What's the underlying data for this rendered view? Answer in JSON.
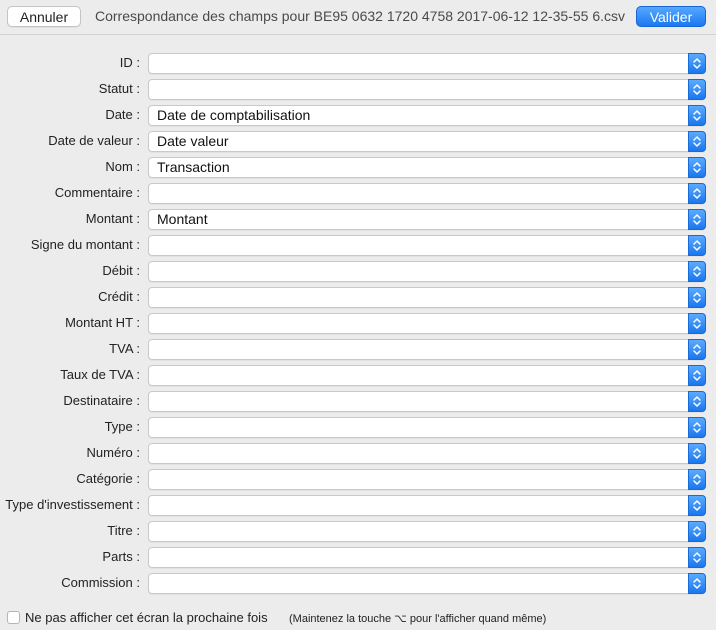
{
  "toolbar": {
    "cancel_label": "Annuler",
    "title": "Correspondance des champs pour BE95 0632 1720 4758 2017-06-12 12-35-55 6.csv",
    "ok_label": "Valider"
  },
  "fields": [
    {
      "label": "ID :",
      "value": ""
    },
    {
      "label": "Statut :",
      "value": ""
    },
    {
      "label": "Date :",
      "value": "Date de comptabilisation"
    },
    {
      "label": "Date de valeur :",
      "value": "Date valeur"
    },
    {
      "label": "Nom :",
      "value": "Transaction"
    },
    {
      "label": "Commentaire :",
      "value": ""
    },
    {
      "label": "Montant :",
      "value": "Montant"
    },
    {
      "label": "Signe du montant :",
      "value": ""
    },
    {
      "label": "Débit :",
      "value": ""
    },
    {
      "label": "Crédit :",
      "value": ""
    },
    {
      "label": "Montant HT :",
      "value": ""
    },
    {
      "label": "TVA :",
      "value": ""
    },
    {
      "label": "Taux de TVA :",
      "value": ""
    },
    {
      "label": "Destinataire :",
      "value": ""
    },
    {
      "label": "Type :",
      "value": ""
    },
    {
      "label": "Numéro :",
      "value": ""
    },
    {
      "label": "Catégorie :",
      "value": ""
    },
    {
      "label": "Type d'investissement :",
      "value": ""
    },
    {
      "label": "Titre :",
      "value": ""
    },
    {
      "label": "Parts :",
      "value": ""
    },
    {
      "label": "Commission :",
      "value": ""
    }
  ],
  "footer": {
    "checkbox_label": "Ne pas afficher cet écran la prochaine fois",
    "checkbox_checked": false,
    "hint": "(Maintenez la touche ⌥ pour l'afficher quand même)"
  },
  "icons": {
    "stepper": "up-down-chevron-icon"
  },
  "colors": {
    "accent": "#1b79f0",
    "window_bg": "#ececec"
  }
}
